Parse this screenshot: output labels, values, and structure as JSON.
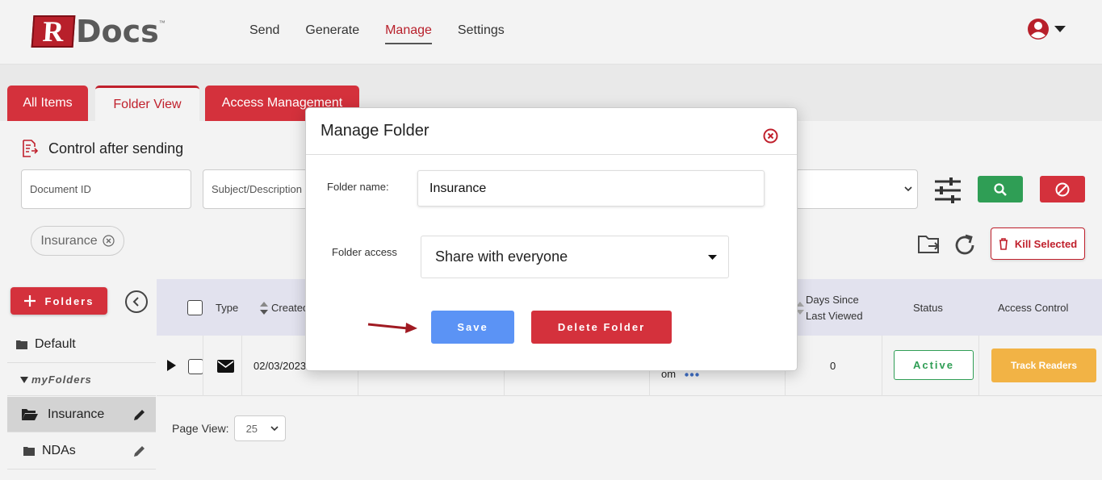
{
  "header": {
    "logo_letter": "R",
    "logo_text": "Docs",
    "logo_tm": "™",
    "nav": [
      {
        "label": "Send",
        "active": false
      },
      {
        "label": "Generate",
        "active": false
      },
      {
        "label": "Manage",
        "active": true
      },
      {
        "label": "Settings",
        "active": false
      }
    ],
    "user_icon": "user-circle-icon"
  },
  "tabs": [
    {
      "label": "All Items",
      "active": false
    },
    {
      "label": "Folder View",
      "active": true
    },
    {
      "label": "Access Management",
      "active": false
    }
  ],
  "section": {
    "title": "Control after sending",
    "icon": "document-send-icon"
  },
  "filters": {
    "document_id_placeholder": "Document ID",
    "subject_placeholder": "Subject/Description"
  },
  "chip": {
    "label": "Insurance"
  },
  "actions": {
    "kill_selected": "Kill Selected"
  },
  "folders": {
    "button_label": "Folders",
    "items": [
      {
        "label": "Default"
      },
      {
        "label": "myFolders"
      },
      {
        "label": "Insurance",
        "selected": true
      },
      {
        "label": "NDAs"
      }
    ]
  },
  "table": {
    "headers": {
      "type": "Type",
      "created": "Created",
      "days_since_line1": "Days Since",
      "days_since_line2": "Last Viewed",
      "status": "Status",
      "access_control": "Access Control"
    },
    "rows": [
      {
        "created": "02/03/2023",
        "truncated": "om",
        "days_since": "0",
        "status": "Active",
        "action": "Track Readers"
      }
    ]
  },
  "pagination": {
    "label": "Page View:",
    "value": "25"
  },
  "modal": {
    "title": "Manage Folder",
    "folder_name_label": "Folder name:",
    "folder_name_value": "Insurance",
    "folder_access_label": "Folder access",
    "folder_access_value": "Share with everyone",
    "save_label": "Save",
    "delete_label": "Delete Folder"
  },
  "colors": {
    "brand_red": "#d4313c",
    "save_blue": "#5b93f5",
    "active_green": "#2f9e55",
    "track_orange": "#f2b345"
  }
}
